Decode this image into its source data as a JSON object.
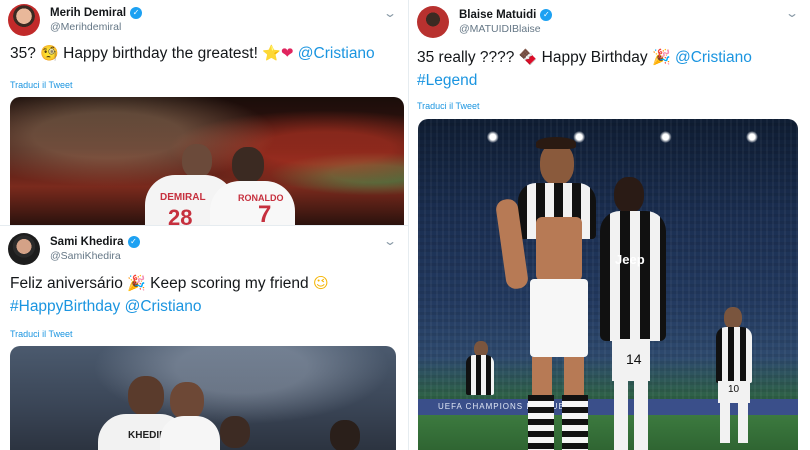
{
  "tweets": [
    {
      "name": "Merih Demiral",
      "handle": "@Merihdemiral",
      "text_pre": "35? ",
      "emoji1": "🧐",
      "text_mid": " Happy birthday the greatest! ",
      "emoji2": "⭐",
      "emoji3": "❤",
      "mention": "@Cristiano",
      "translate": "Traduci il Tweet",
      "jersey_name_left": "DEMIRAL",
      "jersey_name_right": "RONALDO",
      "jersey_number_left": "28",
      "jersey_number_right": "7"
    },
    {
      "name": "Sami Khedira",
      "handle": "@SamiKhedira",
      "text_pre": "Feliz aniversário ",
      "emoji1": "🎉",
      "text_mid": " Keep scoring my friend ",
      "emoji2": "😉",
      "hashtag": "#HappyBirthday",
      "mention": "@Cristiano",
      "translate": "Traduci il Tweet",
      "jersey_name": "KHEDIRA"
    },
    {
      "name": "Blaise Matuidi",
      "handle": "@MATUIDIBlaise",
      "text_pre": "35 really ???? ",
      "emoji1": "🍫",
      "text_mid": " Happy Birthday ",
      "emoji2": "🎉",
      "mention": "@Cristiano",
      "hashtag": "#Legend",
      "translate": "Traduci il Tweet",
      "sponsor": "Jeep",
      "number_right": "14",
      "number_far": "10",
      "board_text": "UEFA CHAMPIONS LEAGUE"
    }
  ],
  "colors": {
    "link": "#1b95e0",
    "verified": "#1da1f2",
    "text": "#14171a",
    "muted": "#657786"
  }
}
